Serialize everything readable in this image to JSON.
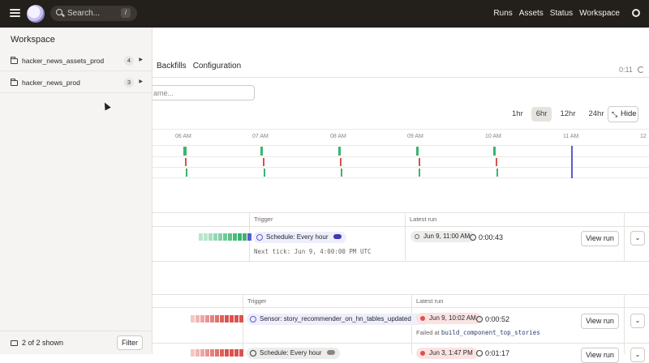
{
  "topbar": {
    "search_placeholder": "Search...",
    "search_shortcut": "/",
    "nav": [
      "Runs",
      "Assets",
      "Status",
      "Workspace"
    ]
  },
  "main": {
    "tabs": [
      "Backfills",
      "Configuration"
    ],
    "timer": "0:11",
    "filter_placeholder": "ame...",
    "ranges": [
      "1hr",
      "6hr",
      "12hr",
      "24hr"
    ],
    "selected_range": "6hr",
    "hide_label": "Hide",
    "timeline_ticks": [
      "06 AM",
      "07 AM",
      "08 AM",
      "09 AM",
      "10 AM",
      "11 AM",
      "12"
    ],
    "table1": {
      "headers": [
        "Trigger",
        "Latest run"
      ],
      "trigger": "Schedule: Every hour",
      "next_tick": "Next tick: Jun 9, 4:00:00 PM UTC",
      "latest_run": "Jun 9, 11:00 AM",
      "duration": "0:00:43",
      "view_label": "View run"
    },
    "table2": {
      "headers": [
        "Trigger",
        "Latest run"
      ],
      "row1": {
        "trigger": "Sensor: story_recommender_on_hn_tables_updated",
        "latest_run": "Jun 9, 10:02 AM",
        "duration": "0:00:52",
        "failed_prefix": "Failed at",
        "failed_step": "build_component_top_stories",
        "view_label": "View run"
      },
      "row2": {
        "trigger": "Schedule: Every hour",
        "latest_run": "Jun 3, 1:47 PM",
        "duration": "0:01:17",
        "view_label": "View run"
      }
    }
  },
  "drawer": {
    "title": "Workspace",
    "items": [
      {
        "name": "hacker_news_assets_prod",
        "count": "4"
      },
      {
        "name": "hacker_news_prod",
        "count": "3"
      }
    ],
    "shown_text": "2 of 2 shown",
    "filter_label": "Filter"
  },
  "colors": {
    "topbar": "#231f1b",
    "success": "#3cb371",
    "failure": "#d9534f",
    "accent": "#5b5bd6"
  }
}
